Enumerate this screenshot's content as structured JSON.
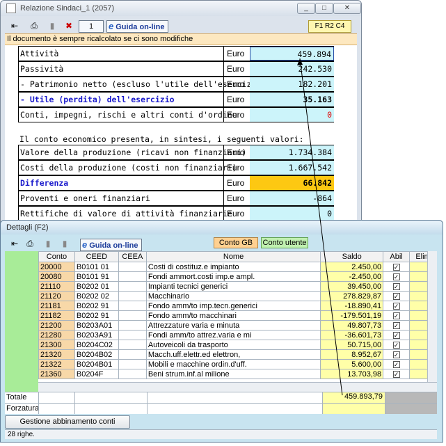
{
  "window_back": {
    "title": "Relazione Sindaci_1 (2057)",
    "page_number": "1",
    "guida_label": "Guida on-line",
    "cell_ref": "F1 R2 C4",
    "info_text": "Il documento è sempre ricalcolato se ci sono modifiche",
    "rows": [
      {
        "label": "Attività",
        "unit": "Euro",
        "value": "459.894"
      },
      {
        "label": "Passività",
        "unit": "Euro",
        "value": "242.530"
      },
      {
        "label": "- Patrimonio netto (escluso l'utile dell'esercizio)",
        "unit": "Euro",
        "value": "182.201"
      },
      {
        "label": "- Utile (perdita) dell'esercizio",
        "unit": "Euro",
        "value": "35.163"
      },
      {
        "label": "Conti, impegni, rischi e altri conti d'ordine",
        "unit": "Euro",
        "value": "0"
      }
    ],
    "section_text": "Il conto economico presenta, in sintesi, i seguenti valori:",
    "rows2": [
      {
        "label": "Valore della produzione (ricavi non finanziari)",
        "unit": "Euro",
        "value": "1.734.384"
      },
      {
        "label": "Costi della produzione (costi non finanziari)",
        "unit": "Euro",
        "value": "1.667.542"
      },
      {
        "label": "Differenza",
        "unit": "Euro",
        "value": "66.842"
      },
      {
        "label": "Proventi e oneri finanziari",
        "unit": "Euro",
        "value": "-864"
      },
      {
        "label": "Rettifiche di valore di attività finanziarie",
        "unit": "Euro",
        "value": "0"
      }
    ]
  },
  "window_front": {
    "title": "Dettagli (F2)",
    "guida_label": "Guida on-line",
    "tab_gb": "Conto GB",
    "tab_utente": "Conto utente",
    "columns": [
      "Conto",
      "CEED",
      "CEEA",
      "Nome",
      "Saldo",
      "Abil",
      "Elim"
    ],
    "rows": [
      {
        "conto": "20000",
        "ceed": "B0101 01",
        "ceea": "",
        "nome": "Costi di costituz.e impianto",
        "saldo": "2.450,00"
      },
      {
        "conto": "20080",
        "ceed": "B0101 91",
        "ceea": "",
        "nome": "Fondi ammort.costi imp.e ampl.",
        "saldo": "-2.450,00"
      },
      {
        "conto": "21110",
        "ceed": "B0202 01",
        "ceea": "",
        "nome": "Impianti tecnici generici",
        "saldo": "39.450,00"
      },
      {
        "conto": "21120",
        "ceed": "B0202 02",
        "ceea": "",
        "nome": "Macchinario",
        "saldo": "278.829,87"
      },
      {
        "conto": "21181",
        "ceed": "B0202 91",
        "ceea": "",
        "nome": "Fondo amm/to imp.tecn.generici",
        "saldo": "-18.890,41"
      },
      {
        "conto": "21182",
        "ceed": "B0202 91",
        "ceea": "",
        "nome": "Fondo amm/to macchinari",
        "saldo": "-179.501,19"
      },
      {
        "conto": "21200",
        "ceed": "B0203A01",
        "ceea": "",
        "nome": "Attrezzature varia e minuta",
        "saldo": "49.807,73"
      },
      {
        "conto": "21280",
        "ceed": "B0203A91",
        "ceea": "",
        "nome": "Fondi amm/to attrez.varia e mi",
        "saldo": "-36.601,73"
      },
      {
        "conto": "21300",
        "ceed": "B0204C02",
        "ceea": "",
        "nome": "Autoveicoli da trasporto",
        "saldo": "50.715,00"
      },
      {
        "conto": "21320",
        "ceed": "B0204B02",
        "ceea": "",
        "nome": "Macch.uff.elettr.ed elettron,",
        "saldo": "8.952,67"
      },
      {
        "conto": "21322",
        "ceed": "B0204B01",
        "ceea": "",
        "nome": "Mobili e macchine ordin.d'uff.",
        "saldo": "5.600,00"
      },
      {
        "conto": "21360",
        "ceed": "B0204F",
        "ceea": "",
        "nome": "Beni strum.inf.al milione",
        "saldo": "13.703,98"
      }
    ],
    "totale_label": "Totale",
    "totale_value": "459.893,79",
    "forzatura_label": "Forzatura",
    "gestione_button": "Gestione abbinamento conti",
    "status": "28 righe."
  },
  "colors": {
    "orange_cell": "#fdc812",
    "cyan_cell": "#ccf4fa",
    "green_column": "#a8ec98",
    "code_cell": "#f8d8a8",
    "yellow_cell": "#ffffa8"
  }
}
